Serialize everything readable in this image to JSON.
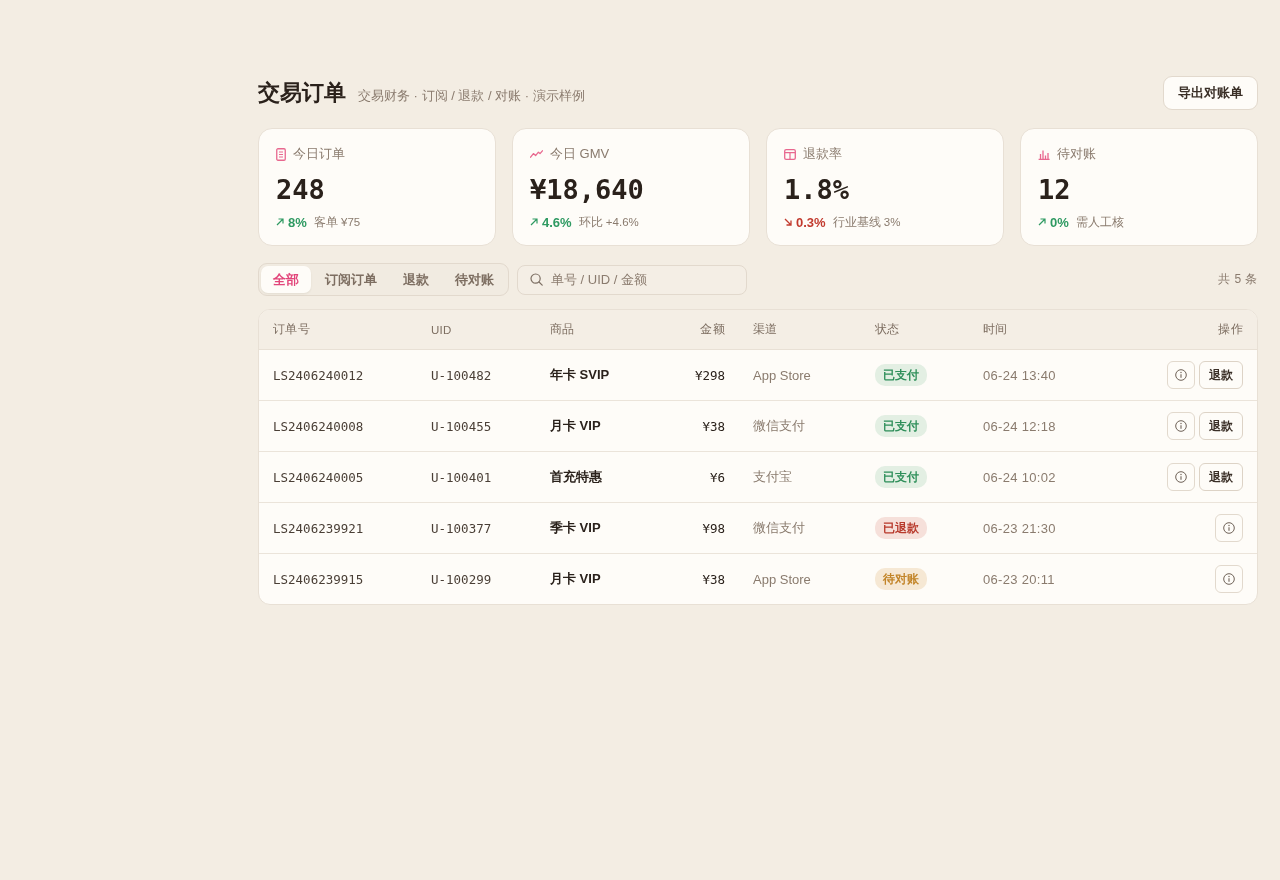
{
  "header": {
    "title": "交易订单",
    "subtitle": "交易财务 · 订阅 / 退款 / 对账 · 演示样例",
    "export_button": "导出对账单"
  },
  "stats": [
    {
      "kind": "orders",
      "label": "今日订单",
      "value": "248",
      "falling": false,
      "delta": "8%",
      "note": "客单 ¥75"
    },
    {
      "kind": "gmv",
      "label": "今日 GMV",
      "value": "¥18,640",
      "falling": false,
      "delta": "4.6%",
      "note": "环比 +4.6%"
    },
    {
      "kind": "refunds",
      "label": "退款率",
      "value": "1.8%",
      "falling": true,
      "delta": "0.3%",
      "note": "行业基线 3%"
    },
    {
      "kind": "pending",
      "label": "待对账",
      "value": "12",
      "falling": false,
      "delta": "0%",
      "note": "需人工核"
    }
  ],
  "filter_tabs": [
    {
      "label": "全部",
      "selected": true
    },
    {
      "label": "订阅订单",
      "selected": false
    },
    {
      "label": "退款",
      "selected": false
    },
    {
      "label": "待对账",
      "selected": false
    }
  ],
  "search": {
    "placeholder": "单号 / UID / 金额"
  },
  "count": "共 5 条",
  "table": {
    "columns": [
      "订单号",
      "UID",
      "商品",
      "金额",
      "渠道",
      "状态",
      "时间",
      "操作"
    ],
    "rows": [
      {
        "order_no": "LS2406240012",
        "uid": "U-100482",
        "product": "年卡 SVIP",
        "amount": "¥298",
        "channel": "App Store",
        "status": {
          "kind": "paid",
          "label": "已支付"
        },
        "time": "06-24 13:40",
        "actions": [
          {
            "kind": "info"
          },
          {
            "kind": "refund",
            "label": "退款"
          }
        ]
      },
      {
        "order_no": "LS2406240008",
        "uid": "U-100455",
        "product": "月卡 VIP",
        "amount": "¥38",
        "channel": "微信支付",
        "status": {
          "kind": "paid",
          "label": "已支付"
        },
        "time": "06-24 12:18",
        "actions": [
          {
            "kind": "info"
          },
          {
            "kind": "refund",
            "label": "退款"
          }
        ]
      },
      {
        "order_no": "LS2406240005",
        "uid": "U-100401",
        "product": "首充特惠",
        "amount": "¥6",
        "channel": "支付宝",
        "status": {
          "kind": "paid",
          "label": "已支付"
        },
        "time": "06-24 10:02",
        "actions": [
          {
            "kind": "info"
          },
          {
            "kind": "refund",
            "label": "退款"
          }
        ]
      },
      {
        "order_no": "LS2406239921",
        "uid": "U-100377",
        "product": "季卡 VIP",
        "amount": "¥98",
        "channel": "微信支付",
        "status": {
          "kind": "refunded",
          "label": "已退款"
        },
        "time": "06-23 21:30",
        "actions": [
          {
            "kind": "info"
          }
        ]
      },
      {
        "order_no": "LS2406239915",
        "uid": "U-100299",
        "product": "月卡 VIP",
        "amount": "¥38",
        "channel": "App Store",
        "status": {
          "kind": "pending",
          "label": "待对账"
        },
        "time": "06-23 20:11",
        "actions": [
          {
            "kind": "info"
          }
        ]
      }
    ]
  }
}
